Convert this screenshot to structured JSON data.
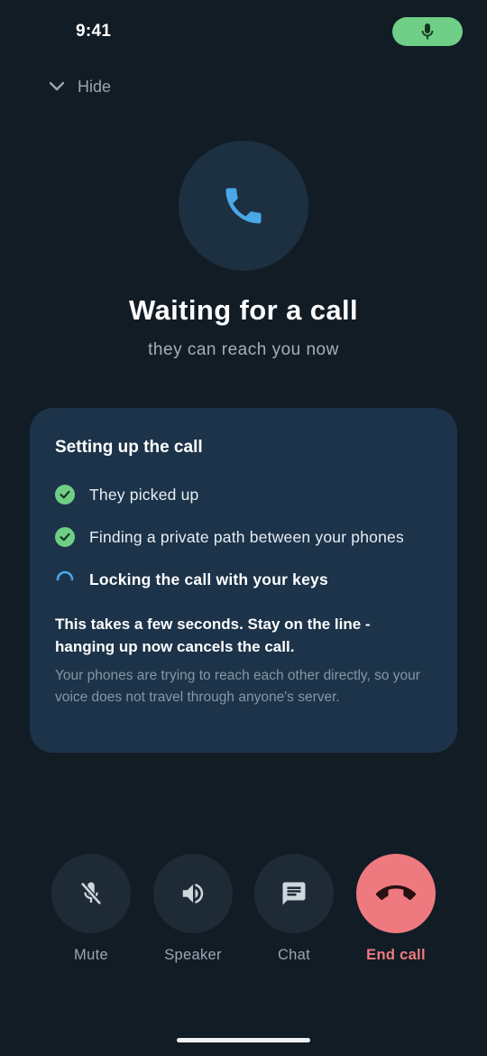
{
  "status_bar": {
    "time": "9:41"
  },
  "header": {
    "hide_label": "Hide"
  },
  "call": {
    "title": "Waiting for a call",
    "subtitle": "they can reach you now"
  },
  "setup_card": {
    "title": "Setting up the call",
    "steps": [
      {
        "label": "They picked up",
        "state": "done"
      },
      {
        "label": "Finding a private path between your phones",
        "state": "done"
      },
      {
        "label": "Locking the call with your keys",
        "state": "in-progress"
      }
    ],
    "note_strong": "This takes a few seconds. Stay on the line - hanging up now cancels the call.",
    "note_muted": "Your phones are trying to reach each other directly, so your voice does not travel through anyone's server."
  },
  "controls": {
    "mute_label": "Mute",
    "speaker_label": "Speaker",
    "chat_label": "Chat",
    "end_call_label": "End call"
  },
  "colors": {
    "background": "#111c25",
    "accent_blue": "#4aa8e8",
    "success_green": "#6fcf86",
    "end_call_red": "#ee7a7f",
    "card": "#1c3349"
  },
  "icons": {
    "status_mic": "mic-icon",
    "hide": "chevron-down-icon",
    "call": "phone-icon",
    "done": "check-circle-icon",
    "in_progress": "spinner-icon",
    "mute": "mic-off-icon",
    "speaker": "volume-icon",
    "chat": "chat-bubble-icon",
    "end_call": "phone-hangup-icon"
  }
}
